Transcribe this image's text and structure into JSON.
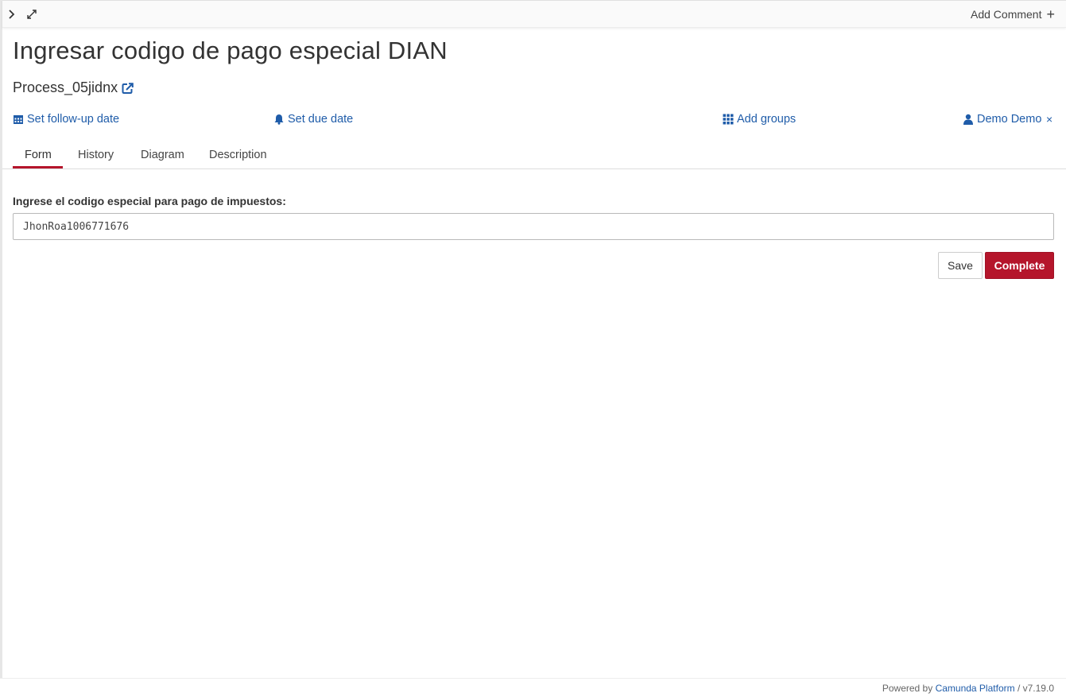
{
  "header": {
    "add_comment_label": "Add Comment"
  },
  "task": {
    "title": "Ingresar codigo de pago especial DIAN",
    "process_name": "Process_05jidnx"
  },
  "actions": {
    "follow_up": "Set follow-up date",
    "due_date": "Set due date",
    "add_groups": "Add groups",
    "assignee": "Demo Demo",
    "remove_assignee": "×"
  },
  "tabs": [
    {
      "label": "Form",
      "active": true
    },
    {
      "label": "History",
      "active": false
    },
    {
      "label": "Diagram",
      "active": false
    },
    {
      "label": "Description",
      "active": false
    }
  ],
  "form": {
    "field_label": "Ingrese el codigo especial para pago de impuestos:",
    "field_value": "JhonRoa1006771676",
    "save_label": "Save",
    "complete_label": "Complete"
  },
  "footer": {
    "powered_by": "Powered by",
    "product": "Camunda Platform",
    "separator": " / ",
    "version": "v7.19.0"
  },
  "colors": {
    "accent": "#b5152b",
    "link": "#1f5ca9"
  },
  "icons": [
    "chevron-right-icon",
    "expand-icon",
    "plus-icon",
    "external-link-icon",
    "calendar-icon",
    "bell-icon",
    "grid-icon",
    "user-icon",
    "close-icon"
  ]
}
